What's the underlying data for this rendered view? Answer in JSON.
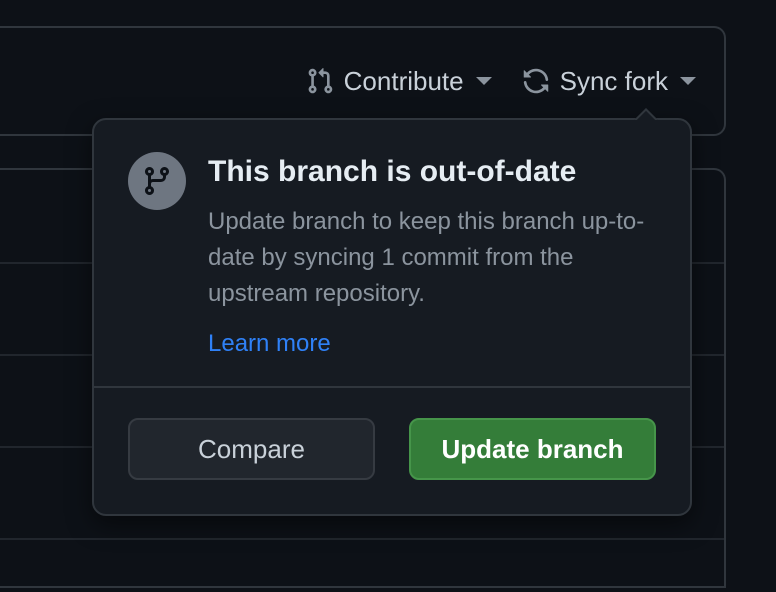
{
  "toolbar": {
    "contribute_label": "Contribute",
    "sync_fork_label": "Sync fork"
  },
  "popover": {
    "title": "This branch is out-of-date",
    "description": "Update branch to keep this branch up-to-date by syncing 1 commit from the upstream repository.",
    "learn_more_label": "Learn more",
    "compare_label": "Compare",
    "update_label": "Update branch"
  }
}
